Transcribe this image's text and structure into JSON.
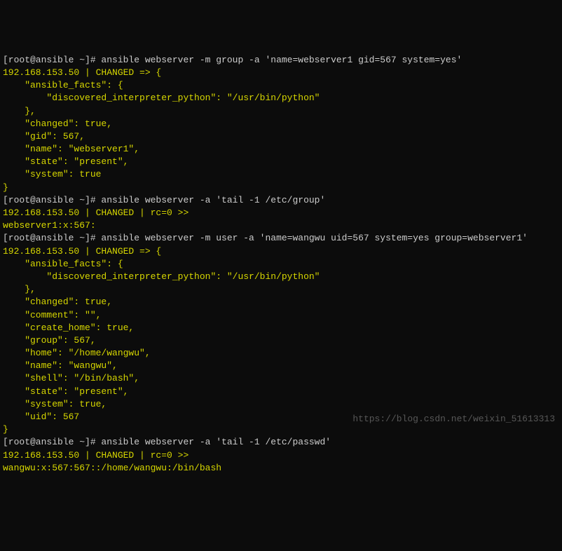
{
  "l1": "[root@ansible ~]# ansible webserver -m group -a 'name=webserver1 gid=567 system=yes'",
  "l2": "192.168.153.50 | CHANGED => {",
  "l3": "    \"ansible_facts\": {",
  "l4": "        \"discovered_interpreter_python\": \"/usr/bin/python\"",
  "l5": "    },",
  "l6": "    \"changed\": true,",
  "l7": "    \"gid\": 567,",
  "l8": "    \"name\": \"webserver1\",",
  "l9": "    \"state\": \"present\",",
  "l10": "    \"system\": true",
  "l11": "}",
  "l12": "[root@ansible ~]# ansible webserver -a 'tail -1 /etc/group'",
  "l13": "192.168.153.50 | CHANGED | rc=0 >>",
  "l14": "webserver1:x:567:",
  "l15": "[root@ansible ~]# ansible webserver -m user -a 'name=wangwu uid=567 system=yes group=webserver1'",
  "l16": "192.168.153.50 | CHANGED => {",
  "l17": "    \"ansible_facts\": {",
  "l18": "        \"discovered_interpreter_python\": \"/usr/bin/python\"",
  "l19": "    },",
  "l20": "    \"changed\": true,",
  "l21": "    \"comment\": \"\",",
  "l22": "    \"create_home\": true,",
  "l23": "    \"group\": 567,",
  "l24": "    \"home\": \"/home/wangwu\",",
  "l25": "    \"name\": \"wangwu\",",
  "l26": "    \"shell\": \"/bin/bash\",",
  "l27": "    \"state\": \"present\",",
  "l28": "    \"system\": true,",
  "l29": "    \"uid\": 567",
  "l30": "}",
  "l31": "[root@ansible ~]# ansible webserver -a 'tail -1 /etc/passwd'",
  "l32": "192.168.153.50 | CHANGED | rc=0 >>",
  "l33": "wangwu:x:567:567::/home/wangwu:/bin/bash",
  "watermark": "https://blog.csdn.net/weixin_51613313"
}
